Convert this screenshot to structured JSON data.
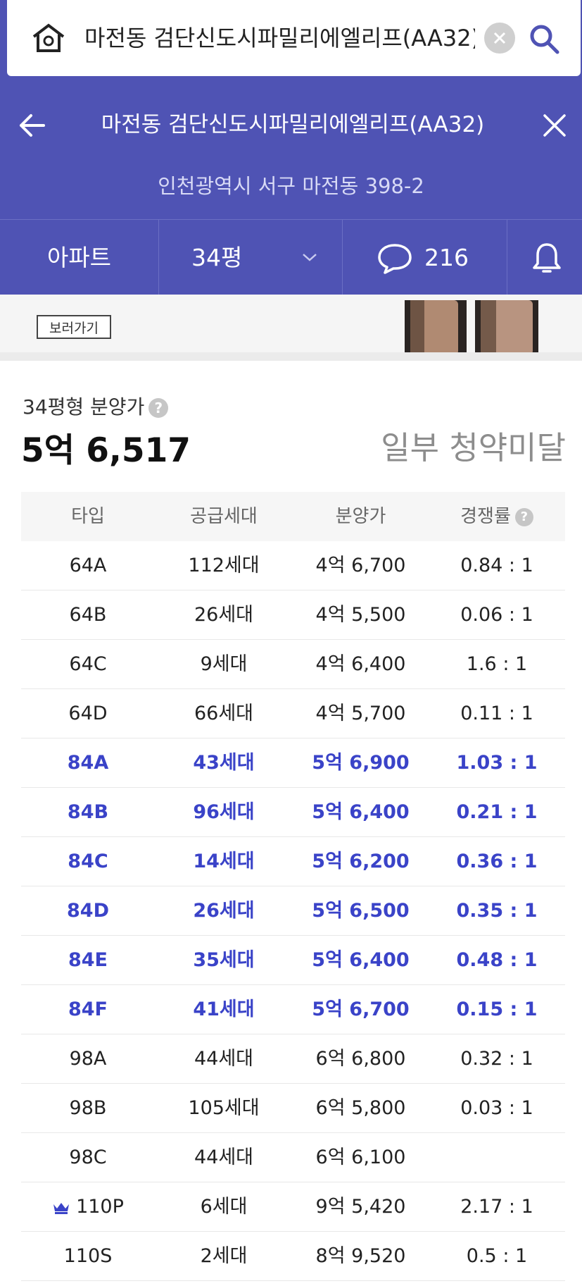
{
  "search": {
    "query": "마전동 검단신도시파밀리에엘리프(AA32)",
    "icon_home": "home-icon",
    "icon_clear": "clear-icon",
    "icon_search": "search-icon"
  },
  "header": {
    "title": "마전동 검단신도시파밀리에엘리프(AA32)",
    "address": "인천광역시 서구 마전동 398-2"
  },
  "tabs": {
    "type_label": "아파트",
    "size_label": "34평",
    "comment_count": "216"
  },
  "banner": {
    "view_label": "보러가기"
  },
  "summary": {
    "price_label": "34평형 분양가",
    "price_value": "5억 6,517",
    "status": "일부 청약미달"
  },
  "table": {
    "headers": [
      "타입",
      "공급세대",
      "분양가",
      "경쟁률"
    ],
    "rows": [
      {
        "type": "64A",
        "units": "112세대",
        "price": "4억 6,700",
        "ratio": "0.84 : 1",
        "highlight": false
      },
      {
        "type": "64B",
        "units": "26세대",
        "price": "4억 5,500",
        "ratio": "0.06 : 1",
        "highlight": false
      },
      {
        "type": "64C",
        "units": "9세대",
        "price": "4억 6,400",
        "ratio": "1.6 : 1",
        "highlight": false
      },
      {
        "type": "64D",
        "units": "66세대",
        "price": "4억 5,700",
        "ratio": "0.11 : 1",
        "highlight": false
      },
      {
        "type": "84A",
        "units": "43세대",
        "price": "5억 6,900",
        "ratio": "1.03 : 1",
        "highlight": true
      },
      {
        "type": "84B",
        "units": "96세대",
        "price": "5억 6,400",
        "ratio": "0.21 : 1",
        "highlight": true
      },
      {
        "type": "84C",
        "units": "14세대",
        "price": "5억 6,200",
        "ratio": "0.36 : 1",
        "highlight": true
      },
      {
        "type": "84D",
        "units": "26세대",
        "price": "5억 6,500",
        "ratio": "0.35 : 1",
        "highlight": true
      },
      {
        "type": "84E",
        "units": "35세대",
        "price": "5억 6,400",
        "ratio": "0.48 : 1",
        "highlight": true
      },
      {
        "type": "84F",
        "units": "41세대",
        "price": "5억 6,700",
        "ratio": "0.15 : 1",
        "highlight": true
      },
      {
        "type": "98A",
        "units": "44세대",
        "price": "6억 6,800",
        "ratio": "0.32 : 1",
        "highlight": false
      },
      {
        "type": "98B",
        "units": "105세대",
        "price": "6억 5,800",
        "ratio": "0.03 : 1",
        "highlight": false
      },
      {
        "type": "98C",
        "units": "44세대",
        "price": "6억 6,100",
        "ratio": "",
        "highlight": false
      },
      {
        "type": "110P",
        "units": "6세대",
        "price": "9억 5,420",
        "ratio": "2.17 : 1",
        "highlight": false,
        "crown": true
      },
      {
        "type": "110S",
        "units": "2세대",
        "price": "8억 9,520",
        "ratio": "0.5 : 1",
        "highlight": false
      }
    ]
  },
  "colors": {
    "brand": "#4f53b4",
    "highlight": "#3a43c8",
    "status": "#8d8d8d"
  }
}
